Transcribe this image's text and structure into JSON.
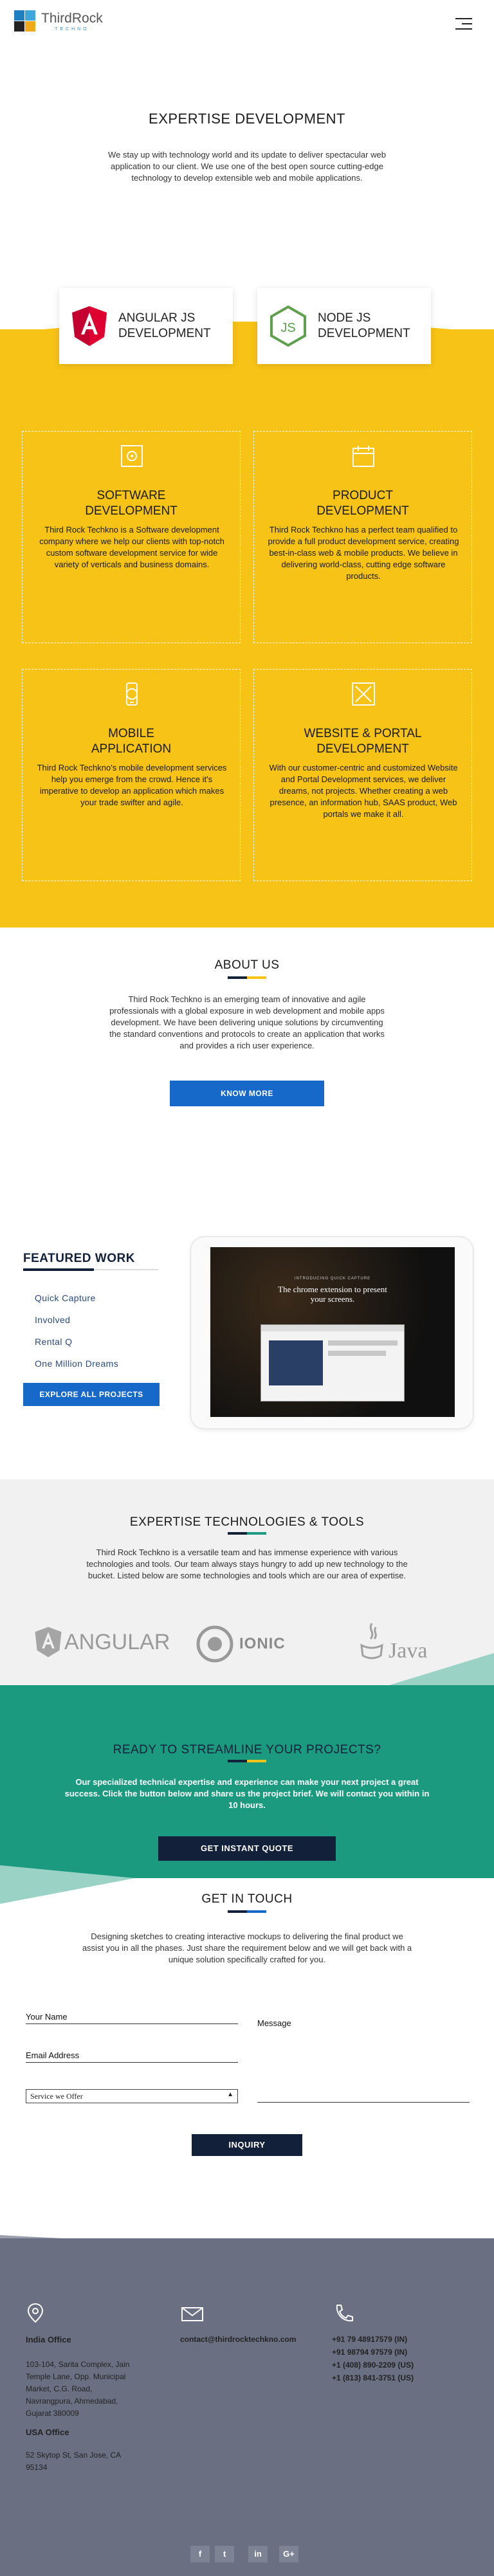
{
  "brand": {
    "name": "ThirdRock",
    "tagline": "TECHNO"
  },
  "expertise": {
    "title": "EXPERTISE DEVELOPMENT",
    "intro": "We stay up with technology world and its update to deliver spectacular web application to our client. We use one of the best open source cutting-edge technology to develop extensible web and mobile applications.",
    "tech_cards": [
      {
        "label_line1": "ANGULAR JS",
        "label_line2": "DEVELOPMENT",
        "icon": "angular-shield-icon"
      },
      {
        "label_line1": "NODE JS",
        "label_line2": "DEVELOPMENT",
        "icon": "nodejs-hexagon-icon"
      }
    ],
    "services": [
      {
        "title_line1": "SOFTWARE",
        "title_line2": "DEVELOPMENT",
        "icon": "software-gear-icon",
        "desc": "Third Rock Techkno is a Software development company where we help our clients with top-notch custom software development service for wide variety of verticals and business domains."
      },
      {
        "title_line1": "PRODUCT",
        "title_line2": "DEVELOPMENT",
        "icon": "product-box-icon",
        "desc": "Third Rock Techkno has a perfect team qualified to provide a full product development service, creating best-in-class web & mobile products. We believe in delivering world-class, cutting edge software products."
      },
      {
        "title_line1": "MOBILE",
        "title_line2": "APPLICATION",
        "icon": "mobile-app-icon",
        "desc": "Third Rock Techkno's mobile development services help you emerge from the crowd. Hence it's imperative to develop an application which makes your trade swifter and agile."
      },
      {
        "title_line1": "WEBSITE & PORTAL",
        "title_line2": "DEVELOPMENT",
        "icon": "website-tools-icon",
        "desc": "With our customer-centric and customized Website and Portal Development services, we deliver dreams, not projects. Whether creating a web presence, an information hub, SAAS product, Web portals we make it all."
      }
    ]
  },
  "about": {
    "title": "ABOUT US",
    "text": "Third Rock Techkno is an emerging team of innovative and agile professionals with a global exposure in web development and mobile apps development. We have been delivering unique solutions by circumventing the standard conventions and protocols to create an application that works and provides a rich user experience.",
    "button": "KNOW MORE"
  },
  "featured": {
    "title": "FEATURED WORK",
    "items": [
      "Quick Capture",
      "Involved",
      "Rental Q",
      "One Million Dreams"
    ],
    "button": "EXPLORE ALL PROJECTS",
    "preview": {
      "kicker": "INTRODUCING QUICK CAPTURE",
      "headline_line1": "The chrome extension to present",
      "headline_line2": "your screens."
    }
  },
  "tools": {
    "title": "EXPERTISE TECHNOLOGIES & TOOLS",
    "text": "Third Rock Techkno is a versatile team and has immense experience with various technologies and tools. Our team always stays hungry to add up new technology to the bucket. Listed below are some technologies and tools which are our area of expertise.",
    "logos": [
      "ANGULAR",
      "IONIC",
      "Java"
    ]
  },
  "cta": {
    "title": "READY TO STREAMLINE YOUR PROJECTS?",
    "text": "Our specialized technical expertise and experience can make your next project a great success. Click the button below and share us the project brief. We will contact you within in 10 hours.",
    "button": "GET INSTANT QUOTE"
  },
  "contact": {
    "title": "GET IN TOUCH",
    "text": "Designing sketches to creating interactive mockups to delivering the final product we assist you in all the phases. Just share the requirement below and we will get back with a unique solution specifically crafted for you.",
    "name_label": "Your Name",
    "email_label": "Email Address",
    "message_label": "Message",
    "service_select": "Service we Offer",
    "button": "INQUIRY"
  },
  "footer": {
    "india_title": "India Office",
    "india_address": [
      "103-104, Sarita Complex, Jain",
      "Temple Lane, Opp. Municipal",
      "Market, C.G. Road,",
      "Navrangpura, Ahmedabad,",
      "Gujarat 380009"
    ],
    "usa_title": "USA Office",
    "usa_address": [
      "52 Skytop St, San Jose, CA",
      "95134"
    ],
    "email": "contact@thirdrocktechkno.com",
    "phones": [
      "+91 79 48917579 (IN)",
      "+91 98794 97579 (IN)",
      "+1 (408) 890-2209 (US)",
      "+1 (813) 841-3751 (US)"
    ],
    "social": [
      "f",
      "t",
      "in",
      "G+"
    ]
  },
  "colors": {
    "yellow": "#f7c316",
    "blue": "#1769c9",
    "navy": "#12203a",
    "green": "#1b9a80",
    "footer": "#6a7082"
  }
}
